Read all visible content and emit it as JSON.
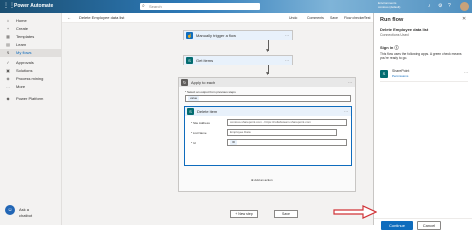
{
  "topbar": {
    "brand": "Power Automate",
    "search_placeholder": "Search",
    "environment_line1": "Environments",
    "environment_line2": "contoso (default)"
  },
  "nav": {
    "items": [
      {
        "label": "Home",
        "icon": "home-icon"
      },
      {
        "label": "Create",
        "icon": "plus-icon"
      },
      {
        "label": "Templates",
        "icon": "template-icon"
      },
      {
        "label": "Learn",
        "icon": "book-icon"
      },
      {
        "label": "My flows",
        "icon": "flow-icon"
      },
      {
        "label": "Approvals",
        "icon": "approval-icon"
      },
      {
        "label": "Solutions",
        "icon": "solution-icon"
      },
      {
        "label": "Process mining",
        "icon": "mining-icon"
      },
      {
        "label": "More",
        "icon": "more-icon"
      },
      {
        "label": "Power Platform",
        "icon": "platform-icon"
      }
    ],
    "ask_chatbot": "Ask a chatbot"
  },
  "cmdbar": {
    "back": "←",
    "title": "Delete Employee data list",
    "undo": "Undo",
    "comments": "Comments",
    "save": "Save",
    "checker": "Flow checker",
    "test": "Test"
  },
  "flow": {
    "trigger": "Manually trigger a flow",
    "get_items": "Get items",
    "apply": "Apply to each",
    "apply_field_label": "* Select an output from previous steps",
    "apply_chip": "value",
    "delete": "Delete item",
    "site_label": "* Site Address",
    "site_value": "contoso.sharepoint.com - https://collabsteam.sharepoint.com",
    "list_label": "* List Name",
    "list_value": "Employee Data",
    "id_label": "* Id",
    "id_chip": "ID",
    "add_action": "Add an action",
    "new_step": "+ New step",
    "save": "Save"
  },
  "runpanel": {
    "title": "Run flow",
    "close": "✕",
    "flow_name": "Delete Employee data list",
    "connections_used": "Connections Used",
    "signin": "Sign in",
    "desc": "This flow uses the following apps. A green check means you're ready to go.",
    "connector_name": "SharePoint",
    "connector_user": "Permissions",
    "continue": "Continue",
    "cancel": "Cancel"
  },
  "colors": {
    "accent": "#0f6cbd",
    "annotation": "#d13438"
  }
}
